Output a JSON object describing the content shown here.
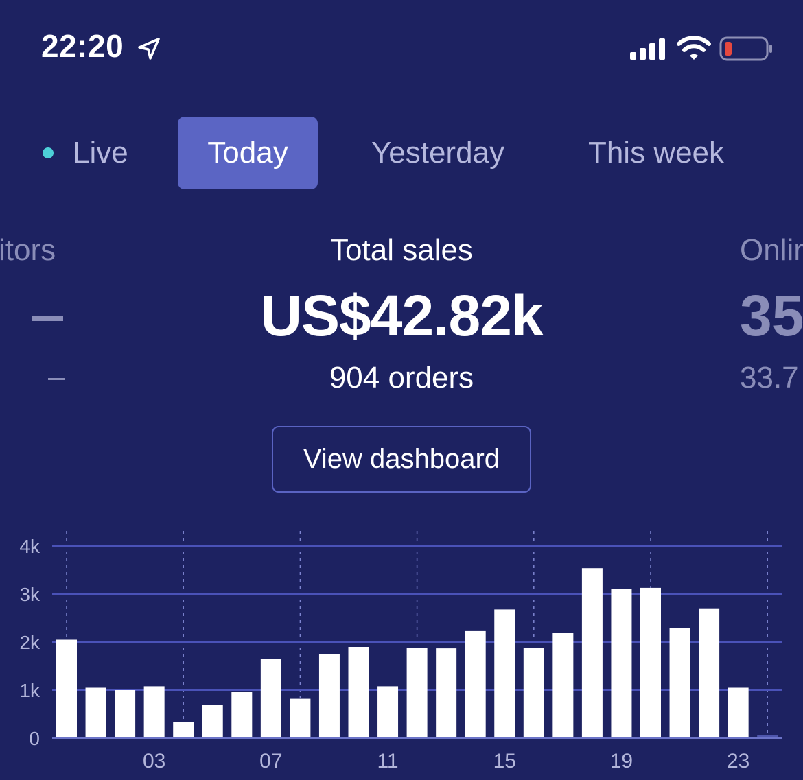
{
  "status_bar": {
    "time": "22:20",
    "icons": [
      "location-arrow-icon",
      "cellular-signal-icon",
      "wifi-icon",
      "battery-low-icon"
    ],
    "battery_color": "#e5483f"
  },
  "tabs": [
    {
      "label": "Live",
      "indicator_color": "#4dd0d8"
    },
    {
      "label": "Today",
      "selected": true
    },
    {
      "label": "Yesterday"
    },
    {
      "label": "This week"
    }
  ],
  "metrics": {
    "left": {
      "title": "itors",
      "value": "–",
      "sub": "–"
    },
    "center": {
      "title": "Total sales",
      "value": "US$42.82k",
      "sub": "904 orders"
    },
    "right": {
      "title": "Onlir",
      "value": "35",
      "sub": "33.7"
    }
  },
  "dashboard_button": {
    "label": "View dashboard"
  },
  "colors": {
    "background": "#1d2261",
    "accent": "#5b65c4",
    "bar": "#ffffff",
    "gridline": "#4a52b8"
  },
  "chart_data": {
    "type": "bar",
    "categories": [
      "00",
      "01",
      "02",
      "03",
      "04",
      "05",
      "06",
      "07",
      "08",
      "09",
      "10",
      "11",
      "12",
      "13",
      "14",
      "15",
      "16",
      "17",
      "18",
      "19",
      "20",
      "21",
      "22",
      "23"
    ],
    "x_tick_labels": [
      "03",
      "07",
      "11",
      "15",
      "19",
      "23"
    ],
    "y_tick_labels": [
      "0",
      "1k",
      "2k",
      "3k",
      "4k"
    ],
    "values": [
      2050,
      1050,
      1000,
      1080,
      330,
      700,
      970,
      1650,
      820,
      1750,
      1900,
      1080,
      1880,
      1870,
      2230,
      2680,
      1880,
      2200,
      3540,
      3100,
      3130,
      2300,
      2690,
      1050,
      60
    ],
    "ylim": [
      0,
      4000
    ],
    "grid": true,
    "series_color": "#ffffff"
  }
}
